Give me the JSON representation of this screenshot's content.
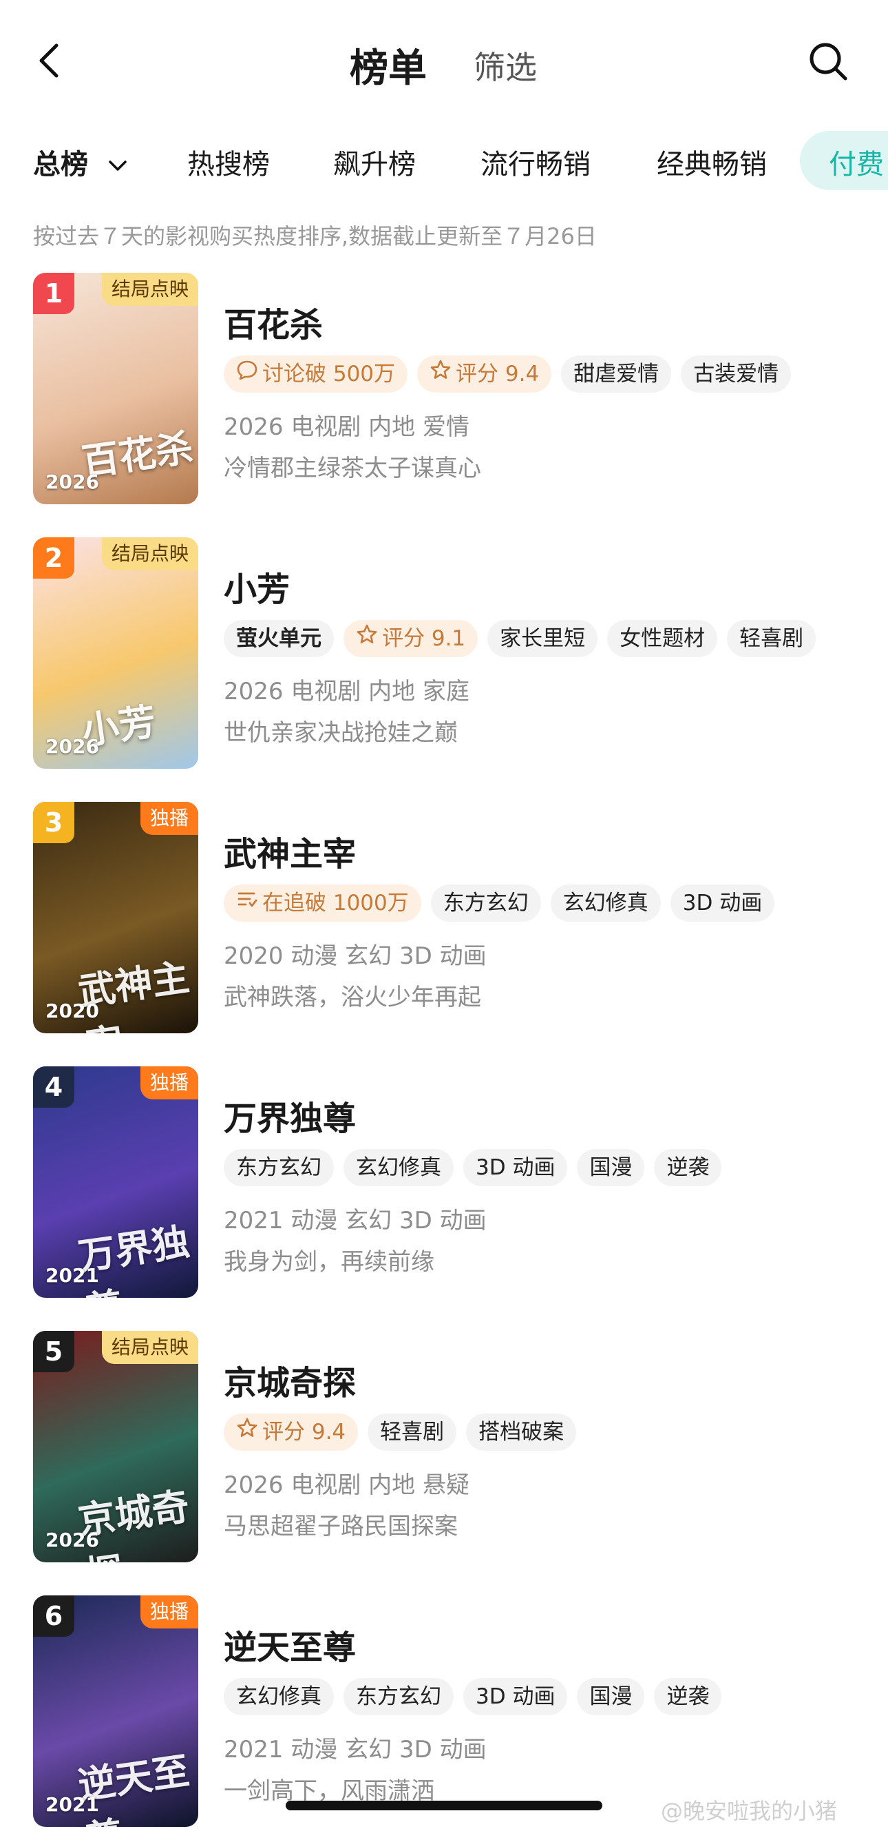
{
  "header": {
    "title": "榜单",
    "filter": "筛选"
  },
  "tabs": [
    {
      "label": "总榜"
    },
    {
      "label": "热搜榜"
    },
    {
      "label": "飙升榜"
    },
    {
      "label": "流行畅销"
    },
    {
      "label": "经典畅销"
    },
    {
      "label": "付费"
    }
  ],
  "subtitle": "按过去７天的影视购买热度排序,数据截止更新至７月26日",
  "items": [
    {
      "rank": "1",
      "rank_color": "#f0484e",
      "badge": "结局点映",
      "badge_style": "yellow",
      "poster_year": "2026",
      "poster_art": "百花杀",
      "poster_colors": [
        "#f6e5d8",
        "#e9bfa0",
        "#b47a4e"
      ],
      "title": "百花杀",
      "tags": [
        {
          "label": "讨论破 500万",
          "style": "hot",
          "icon": "chat-icon"
        },
        {
          "label": "评分 9.4",
          "style": "hot",
          "icon": "star-icon"
        },
        {
          "label": "甜虐爱情",
          "style": "plain"
        },
        {
          "label": "古装爱情",
          "style": "plain"
        }
      ],
      "meta": "2026 电视剧 内地 爱情",
      "desc": "冷情郡主绿茶太子谋真心"
    },
    {
      "rank": "2",
      "rank_color": "#ff7a1a",
      "badge": "结局点映",
      "badge_style": "yellow",
      "poster_year": "2026",
      "poster_art": "小芳",
      "poster_colors": [
        "#fbe2e6",
        "#f7c86d",
        "#9fc7ea"
      ],
      "title": "小芳",
      "tags": [
        {
          "label": "萤火单元",
          "style": "brand"
        },
        {
          "label": "评分 9.1",
          "style": "hot",
          "icon": "star-icon"
        },
        {
          "label": "家长里短",
          "style": "plain"
        },
        {
          "label": "女性题材",
          "style": "plain"
        },
        {
          "label": "轻喜剧",
          "style": "plain"
        }
      ],
      "meta": "2026 电视剧 内地 家庭",
      "desc": "世仇亲家决战抢娃之巅"
    },
    {
      "rank": "3",
      "rank_color": "#f5b321",
      "badge": "独播",
      "badge_style": "orange",
      "poster_year": "2020",
      "poster_art": "武神主宰",
      "poster_colors": [
        "#3a2a12",
        "#7a5a24",
        "#1a1208"
      ],
      "title": "武神主宰",
      "tags": [
        {
          "label": "在追破 1000万",
          "style": "hot",
          "icon": "list-icon"
        },
        {
          "label": "东方玄幻",
          "style": "plain"
        },
        {
          "label": "玄幻修真",
          "style": "plain"
        },
        {
          "label": "3D 动画",
          "style": "plain"
        }
      ],
      "meta": "2020 动漫 玄幻 3D 动画",
      "desc": "武神跌落，浴火少年再起"
    },
    {
      "rank": "4",
      "rank_color": "#1f2a48",
      "badge": "独播",
      "badge_style": "orange",
      "poster_year": "2021",
      "poster_art": "万界独尊",
      "poster_colors": [
        "#2d3a8c",
        "#5a3fb0",
        "#101838"
      ],
      "title": "万界独尊",
      "tags": [
        {
          "label": "东方玄幻",
          "style": "plain"
        },
        {
          "label": "玄幻修真",
          "style": "plain"
        },
        {
          "label": "3D 动画",
          "style": "plain"
        },
        {
          "label": "国漫",
          "style": "plain"
        },
        {
          "label": "逆袭",
          "style": "plain"
        }
      ],
      "meta": "2021 动漫 玄幻 3D 动画",
      "desc": "我身为剑，再续前缘"
    },
    {
      "rank": "5",
      "rank_color": "#1d1d1d",
      "badge": "结局点映",
      "badge_style": "yellow",
      "poster_year": "2026",
      "poster_art": "京城奇探",
      "poster_colors": [
        "#7a1d1d",
        "#2f6a5a",
        "#1d1d1d"
      ],
      "title": "京城奇探",
      "tags": [
        {
          "label": "评分 9.4",
          "style": "hot",
          "icon": "star-icon"
        },
        {
          "label": "轻喜剧",
          "style": "plain"
        },
        {
          "label": "搭档破案",
          "style": "plain"
        }
      ],
      "meta": "2026 电视剧 内地 悬疑",
      "desc": "马思超翟子路民国探案"
    },
    {
      "rank": "6",
      "rank_color": "#1d1d1d",
      "badge": "独播",
      "badge_style": "orange",
      "poster_year": "2021",
      "poster_art": "逆天至尊",
      "poster_colors": [
        "#1b2a55",
        "#6a4aa8",
        "#0d1328"
      ],
      "title": "逆天至尊",
      "tags": [
        {
          "label": "玄幻修真",
          "style": "plain"
        },
        {
          "label": "东方玄幻",
          "style": "plain"
        },
        {
          "label": "3D 动画",
          "style": "plain"
        },
        {
          "label": "国漫",
          "style": "plain"
        },
        {
          "label": "逆袭",
          "style": "plain"
        }
      ],
      "meta": "2021 动漫 玄幻 3D 动画",
      "desc": "一剑高下，风雨潇洒"
    }
  ],
  "watermark": "@晚安啦我的小猪"
}
